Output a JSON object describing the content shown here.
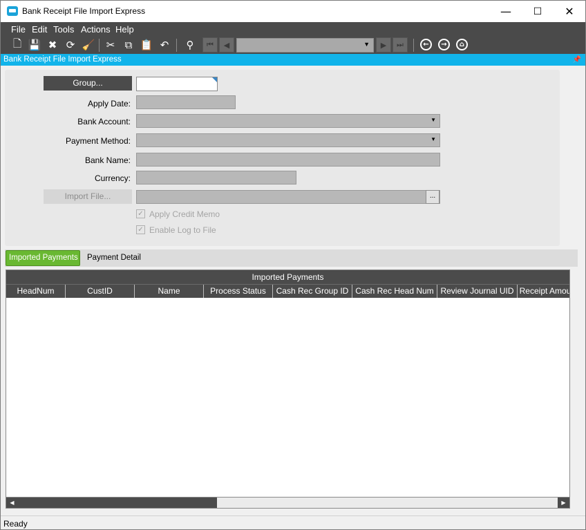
{
  "window": {
    "title": "Bank Receipt File Import Express",
    "minimize": "—",
    "maximize": "☐",
    "close": "✕"
  },
  "menu": {
    "items": [
      {
        "label": "File"
      },
      {
        "label": "Edit"
      },
      {
        "label": "Tools"
      },
      {
        "label": "Actions"
      },
      {
        "label": "Help"
      }
    ]
  },
  "toolbar": {
    "new": "🗋",
    "save": "💾",
    "delete": "✖",
    "refresh": "⟳",
    "clear": "🧹",
    "cut": "✂",
    "copy": "⧉",
    "paste": "📋",
    "undo": "↶",
    "search": "⚲",
    "first": "⏮",
    "prev": "◀",
    "next": "▶",
    "last": "⏭",
    "back": "←",
    "forward": "→",
    "home": "⌂",
    "combo_arrow": "▼"
  },
  "panel": {
    "title": "Bank Receipt File Import Express",
    "pin": "📌"
  },
  "form": {
    "group_button": "Group...",
    "apply_date_label": "Apply Date:",
    "bank_account_label": "Bank Account:",
    "payment_method_label": "Payment Method:",
    "bank_name_label": "Bank Name:",
    "currency_label": "Currency:",
    "import_file_button": "Import File...",
    "ellipsis": "...",
    "dropdown_arrow": "▼",
    "apply_credit_memo": "Apply Credit Memo",
    "enable_log": "Enable Log to File",
    "checkmark": "✓"
  },
  "tabs": [
    {
      "label": "Imported Payments",
      "active": true
    },
    {
      "label": "Payment Detail",
      "active": false
    }
  ],
  "grid": {
    "title": "Imported Payments",
    "columns": [
      "HeadNum",
      "CustID",
      "Name",
      "Process Status",
      "Cash Rec Group ID",
      "Cash Rec Head Num",
      "Review Journal UID",
      "Receipt Amou"
    ],
    "scroll_left": "◀",
    "scroll_right": "▶"
  },
  "status": {
    "text": "Ready"
  },
  "colors": {
    "accent": "#12b4ea",
    "tab_active": "#69b832",
    "dark_bar": "#4a4a4a"
  }
}
